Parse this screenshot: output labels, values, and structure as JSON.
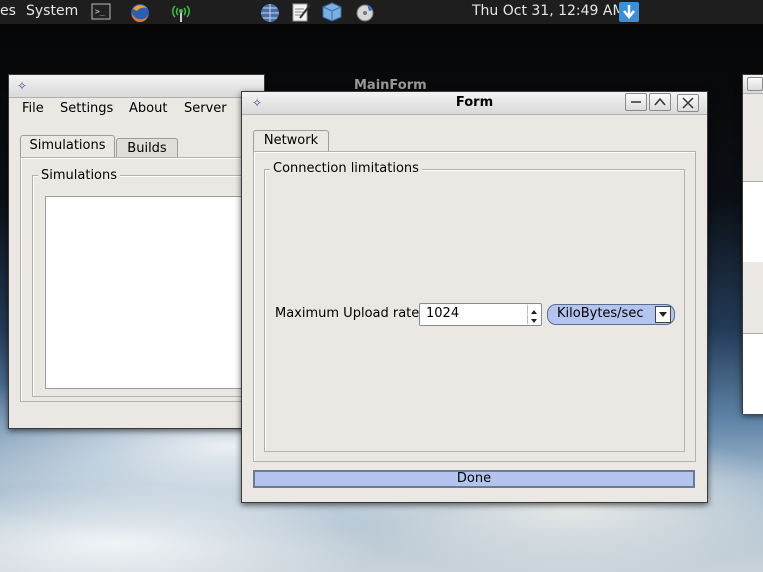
{
  "panel": {
    "apps_label": "es",
    "system_label": "System",
    "clock": "Thu Oct 31, 12:49 AM",
    "icons": [
      "terminal-icon",
      "firefox-icon",
      "network-antenna-icon",
      "globe-icon",
      "text-editor-icon",
      "package-icon",
      "disc-burner-icon",
      "update-notifier-icon"
    ]
  },
  "main_window": {
    "title": "MainForm",
    "menu": [
      "File",
      "Settings",
      "About",
      "Server"
    ],
    "tabs": [
      "Simulations",
      "Builds"
    ],
    "group_label": "Simulations"
  },
  "form_window": {
    "title": "Form",
    "tab": "Network",
    "group_label": "Connection limitations",
    "upload_label": "Maximum Upload rate:",
    "upload_value": "1024",
    "unit_value": "KiloBytes/sec",
    "done_label": "Done"
  }
}
